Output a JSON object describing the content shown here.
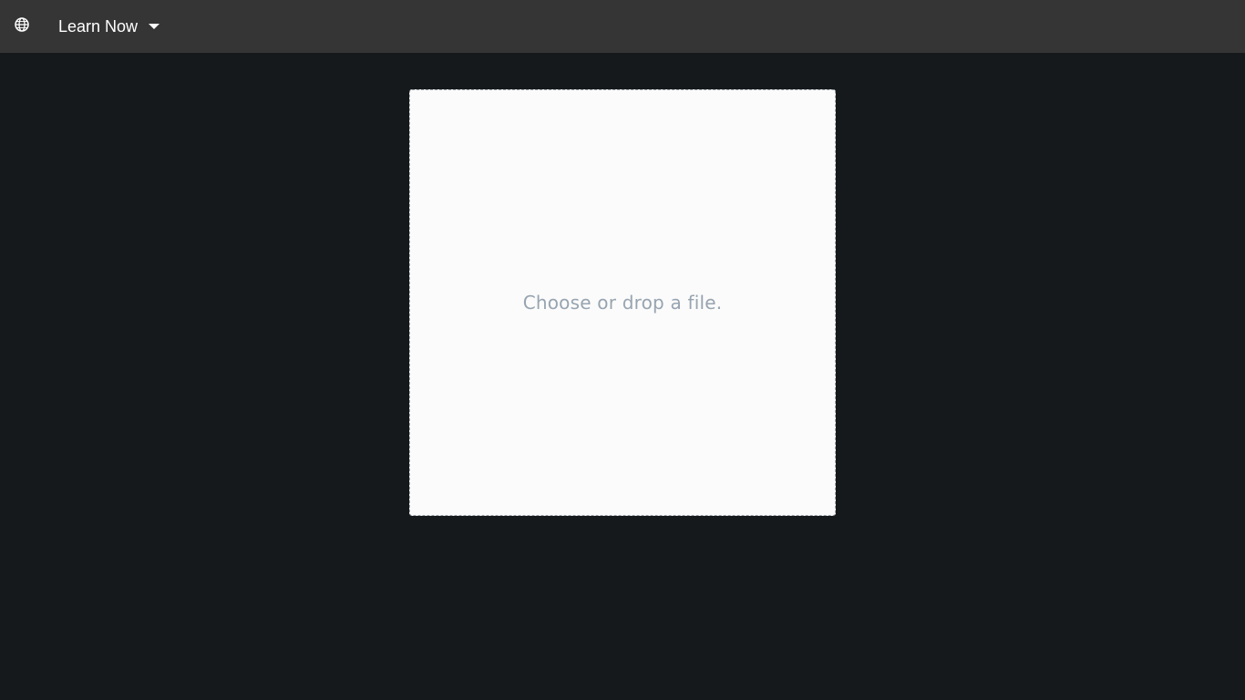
{
  "header": {
    "menu_label": "Learn Now",
    "icons": {
      "language": "globe-icon",
      "dropdown": "caret-down-icon"
    }
  },
  "main": {
    "dropzone_text": "Choose or drop a file."
  },
  "colors": {
    "page_background": "#15191c",
    "header_background": "#353535",
    "dropzone_background": "#fbfbfb",
    "dropzone_text": "#97a4b0"
  }
}
